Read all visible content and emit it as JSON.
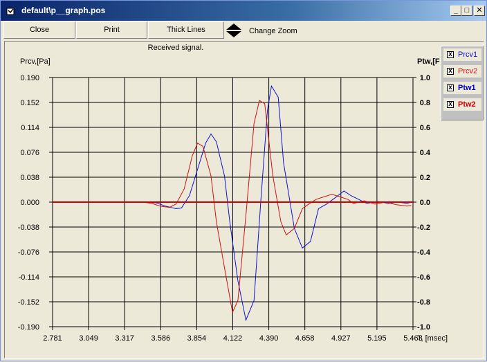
{
  "window": {
    "title": "default\\p__graph.pos",
    "minimize_glyph": "_",
    "maximize_glyph": "□",
    "close_glyph": "✕"
  },
  "toolbar": {
    "close_label": "Close",
    "print_label": "Print",
    "thick_lines_label": "Thick Lines",
    "change_zoom_label": "Change Zoom"
  },
  "colors": {
    "prcv1": "#1010d0",
    "prcv2": "#d01010",
    "ptw1": "#0000c8",
    "ptw2": "#c80000",
    "grid": "#000000"
  },
  "chart_data": {
    "type": "line",
    "title": "Received signal.",
    "ylabel_left": "Prcv,[Pa]",
    "ylabel_right": "Ptw,[F",
    "xunit_label": "T, [msec]",
    "x_ticks": [
      "2.781",
      "3.049",
      "3.317",
      "3.586",
      "3.854",
      "4.122",
      "4.390",
      "4.658",
      "4.927",
      "5.195",
      "5.463"
    ],
    "y_ticks_left": [
      "0.190",
      "0.152",
      "0.114",
      "0.076",
      "0.038",
      "0.000",
      "-0.038",
      "-0.076",
      "-0.114",
      "-0.152",
      "-0.190"
    ],
    "y_ticks_right": [
      "1.0",
      "0.8",
      "0.6",
      "0.4",
      "0.2",
      "0.0",
      "-0.2",
      "-0.4",
      "-0.6",
      "-0.8",
      "-1.0"
    ],
    "xlim": [
      2.781,
      5.463
    ],
    "ylim_left": [
      -0.19,
      0.19
    ],
    "ylim_right": [
      -1.0,
      1.0
    ],
    "grid": true,
    "legend": "top-right",
    "series": [
      {
        "name": "Prcv1",
        "axis": "left",
        "x": [
          2.781,
          3.45,
          3.55,
          3.62,
          3.7,
          3.74,
          3.8,
          3.86,
          3.92,
          3.96,
          4.0,
          4.06,
          4.1,
          4.16,
          4.22,
          4.28,
          4.33,
          4.38,
          4.41,
          4.46,
          4.5,
          4.58,
          4.64,
          4.7,
          4.76,
          4.82,
          4.88,
          4.95,
          5.0,
          5.06,
          5.12,
          5.2,
          5.28,
          5.35,
          5.42,
          5.45
        ],
        "values": [
          0.0,
          0.0,
          -0.001,
          -0.006,
          -0.01,
          -0.009,
          0.01,
          0.05,
          0.09,
          0.104,
          0.092,
          0.04,
          -0.03,
          -0.12,
          -0.18,
          -0.15,
          0.0,
          0.14,
          0.177,
          0.16,
          0.06,
          -0.04,
          -0.07,
          -0.06,
          -0.01,
          -0.003,
          0.006,
          0.017,
          0.01,
          0.004,
          -0.002,
          0.001,
          -0.002,
          0.0,
          -0.002,
          0.0
        ]
      },
      {
        "name": "Prcv2",
        "axis": "left",
        "x": [
          2.781,
          3.45,
          3.52,
          3.58,
          3.65,
          3.7,
          3.76,
          3.82,
          3.86,
          3.9,
          3.96,
          4.0,
          4.06,
          4.12,
          4.16,
          4.22,
          4.28,
          4.32,
          4.36,
          4.42,
          4.48,
          4.52,
          4.58,
          4.64,
          4.68,
          4.74,
          4.8,
          4.86,
          4.92,
          4.98,
          5.02,
          5.1,
          5.18,
          5.26,
          5.34,
          5.42,
          5.45
        ],
        "values": [
          0.0,
          0.0,
          -0.002,
          -0.006,
          -0.008,
          -0.003,
          0.02,
          0.07,
          0.09,
          0.085,
          0.04,
          -0.03,
          -0.1,
          -0.168,
          -0.15,
          -0.02,
          0.12,
          0.155,
          0.15,
          0.04,
          -0.03,
          -0.05,
          -0.04,
          -0.01,
          -0.004,
          0.004,
          0.008,
          0.012,
          0.008,
          0.004,
          -0.002,
          0.002,
          -0.003,
          0.0,
          -0.004,
          -0.006,
          -0.005
        ]
      },
      {
        "name": "Ptw1",
        "axis": "right",
        "x": [
          2.781,
          5.463
        ],
        "values": [
          0.0,
          0.0
        ]
      },
      {
        "name": "Ptw2",
        "axis": "right",
        "x": [
          2.781,
          5.463
        ],
        "values": [
          0.0,
          0.0
        ]
      }
    ]
  }
}
